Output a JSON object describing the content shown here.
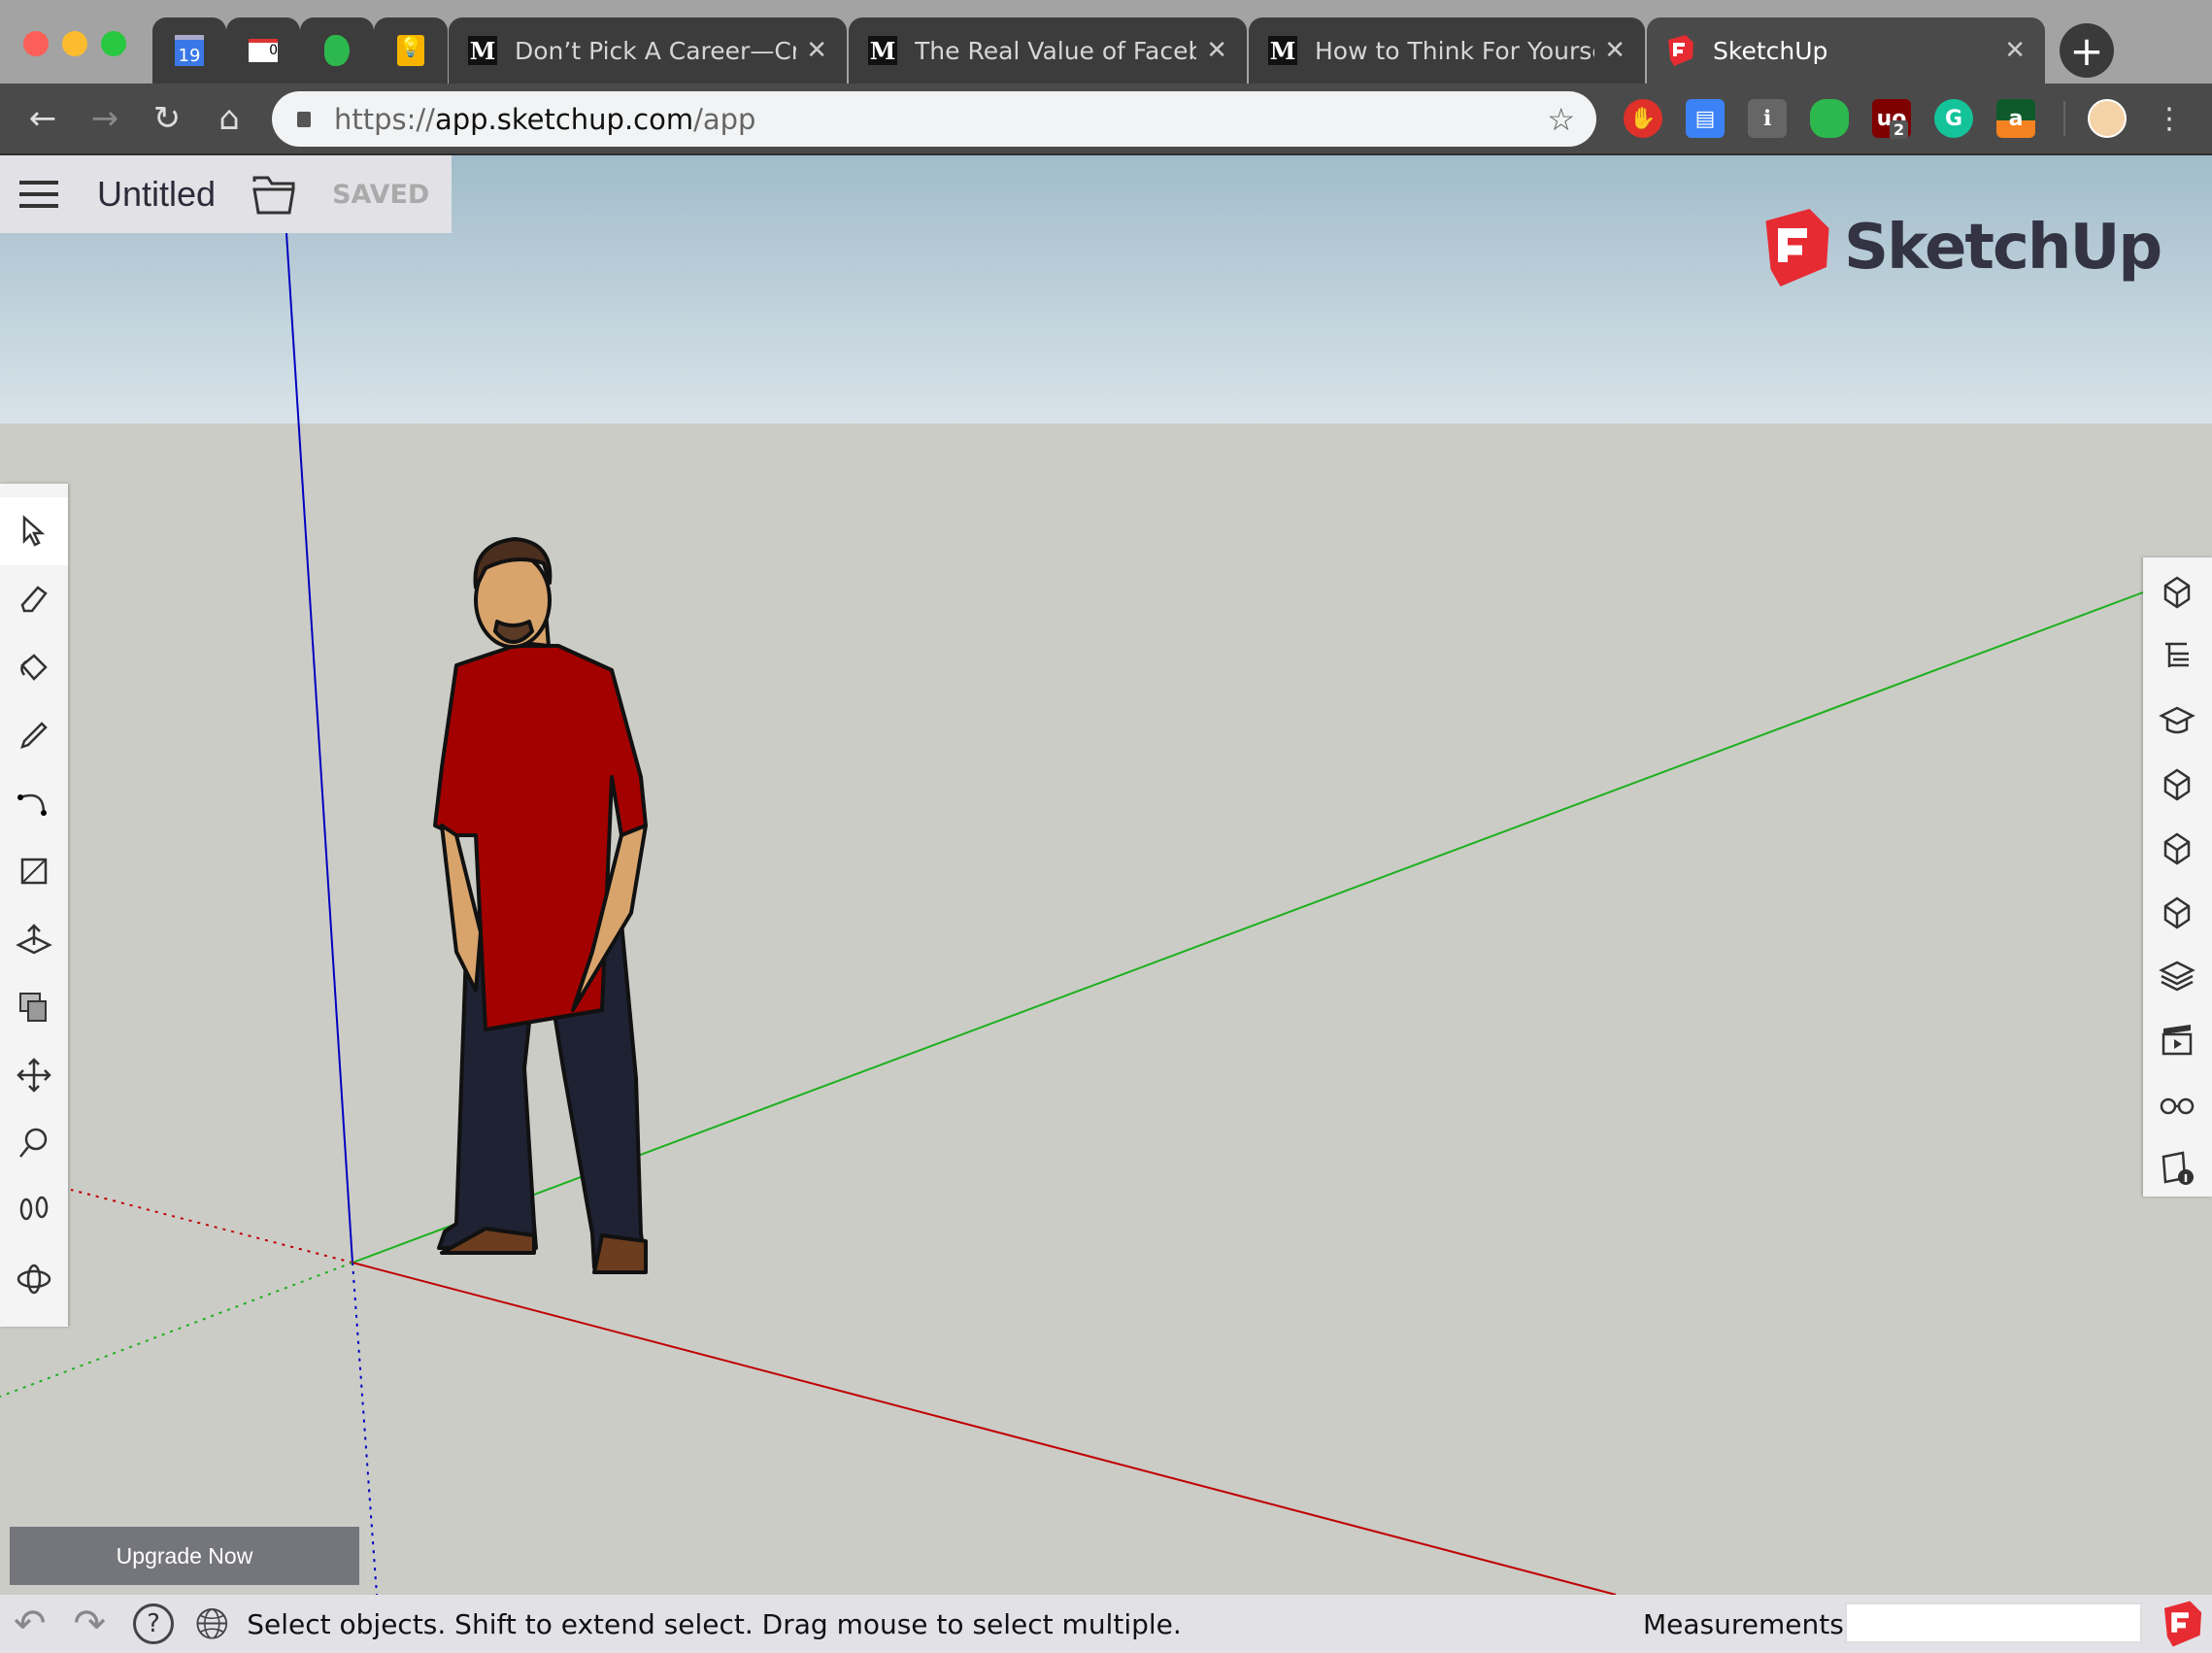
{
  "browser": {
    "pinned_tabs": [
      {
        "icon": "google-calendar-icon",
        "text": "19"
      },
      {
        "icon": "gmail-icon",
        "text": "0"
      },
      {
        "icon": "evernote-icon"
      },
      {
        "icon": "google-keep-icon"
      }
    ],
    "tabs": [
      {
        "title": "Don’t Pick A Career—Cre",
        "icon": "medium-icon",
        "favicon_text": "M"
      },
      {
        "title": "The Real Value of Facebo",
        "icon": "medium-icon",
        "favicon_text": "M"
      },
      {
        "title": "How to Think For Yoursel",
        "icon": "medium-icon",
        "favicon_text": "M"
      },
      {
        "title": "SketchUp",
        "icon": "sketchup-icon",
        "active": true
      }
    ],
    "url": {
      "scheme": "https://",
      "host": "app.sketchup.com",
      "path": "/app"
    },
    "extensions": [
      {
        "name": "hand-stop-icon",
        "color": "#e0302a"
      },
      {
        "name": "reader-icon",
        "color": "#3b82f6"
      },
      {
        "name": "lightbulb-icon",
        "color": "#666666"
      },
      {
        "name": "evernote-icon",
        "color": "#2db84d"
      },
      {
        "name": "ublock-icon",
        "color": "#800000",
        "badge": "2",
        "text": "uo"
      },
      {
        "name": "grammarly-icon",
        "color": "#15c39a",
        "text": "G"
      },
      {
        "name": "amazon-icon",
        "color": "#f58220",
        "text": "a"
      }
    ]
  },
  "app": {
    "file_title": "Untitled",
    "save_status": "SAVED",
    "logo_text": "SketchUp",
    "brand_color": "#e72b33",
    "left_tools": [
      "select-icon",
      "eraser-icon",
      "paint-bucket-icon",
      "pencil-icon",
      "arc-icon",
      "rectangle-icon",
      "push-pull-icon",
      "offset-icon",
      "move-icon",
      "tape-measure-icon",
      "walk-icon",
      "orbit-icon"
    ],
    "right_panels": [
      "entity-info-icon",
      "outliner-icon",
      "instructor-icon",
      "components-icon",
      "materials-icon",
      "styles-icon",
      "layers-icon",
      "scenes-icon",
      "display-icon",
      "model-info-icon"
    ],
    "upgrade_label": "Upgrade Now",
    "status_text": "Select objects. Shift to extend select. Drag mouse to select multiple.",
    "measurements_label": "Measurements",
    "measurements_value": "",
    "axis_colors": {
      "red": "#c00000",
      "green": "#1db01d",
      "blue": "#0000c0"
    }
  }
}
